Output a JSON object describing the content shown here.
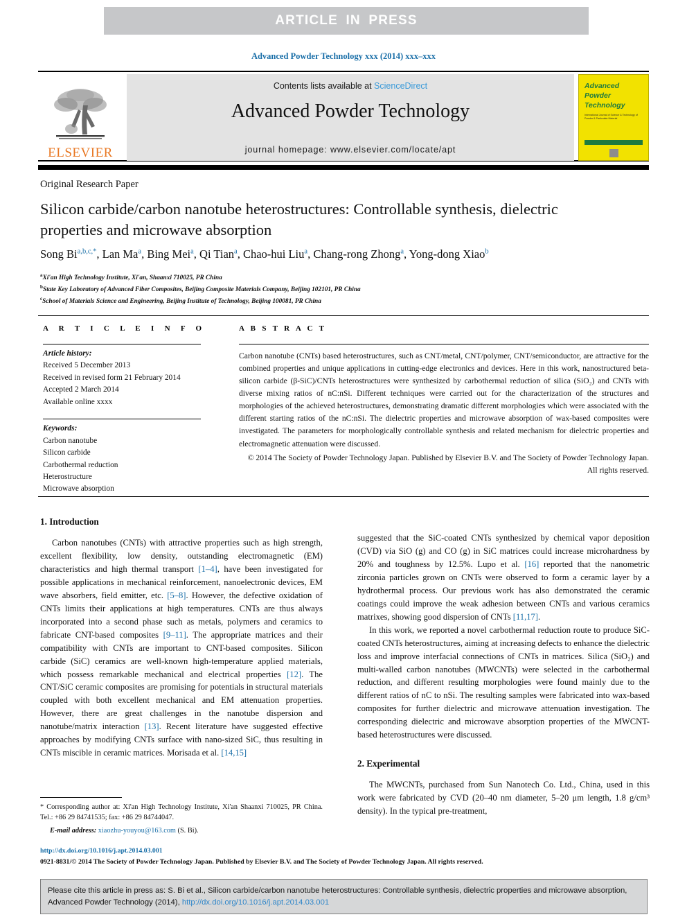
{
  "banner": {
    "label": "ARTICLE IN PRESS"
  },
  "running_head": "Advanced Powder Technology xxx (2014) xxx–xxx",
  "masthead": {
    "publisher_wordmark": "ELSEVIER",
    "contents_prefix": "Contents lists available at ",
    "contents_link": "ScienceDirect",
    "journal_title": "Advanced Powder Technology",
    "homepage": "journal homepage: www.elsevier.com/locate/apt",
    "cover": {
      "line1": "Advanced",
      "line2": "Powder",
      "line3": "Technology",
      "subtitle": "International Journal of Science & Technology of Powder & Particulate Material"
    }
  },
  "article": {
    "type": "Original Research Paper",
    "title": "Silicon carbide/carbon nanotube heterostructures: Controllable synthesis, dielectric properties and microwave absorption",
    "authors": [
      {
        "name": "Song Bi",
        "sup": "a,b,c,*"
      },
      {
        "name": "Lan Ma",
        "sup": "a"
      },
      {
        "name": "Bing Mei",
        "sup": "a"
      },
      {
        "name": "Qi Tian",
        "sup": "a"
      },
      {
        "name": "Chao-hui Liu",
        "sup": "a"
      },
      {
        "name": "Chang-rong Zhong",
        "sup": "a"
      },
      {
        "name": "Yong-dong Xiao",
        "sup": "b"
      }
    ],
    "affiliations": [
      {
        "marker": "a",
        "text": "Xi'an High Technology Institute, Xi'an, Shaanxi 710025, PR China"
      },
      {
        "marker": "b",
        "text": "State Key Laboratory of Advanced Fiber Composites, Beijing Composite Materials Company, Beijing 102101, PR China"
      },
      {
        "marker": "c",
        "text": "School of Materials Science and Engineering, Beijing Institute of Technology, Beijing 100081, PR China"
      }
    ]
  },
  "info_panel": {
    "heading_info": "A R T I C L E   I N F O",
    "heading_abstract": "A B S T R A C T",
    "history_label": "Article history:",
    "history": [
      "Received 5 December 2013",
      "Received in revised form 21 February 2014",
      "Accepted 2 March 2014",
      "Available online xxxx"
    ],
    "keywords_label": "Keywords:",
    "keywords": [
      "Carbon nanotube",
      "Silicon carbide",
      "Carbothermal reduction",
      "Heterostructure",
      "Microwave absorption"
    ]
  },
  "abstract": {
    "text": "Carbon nanotube (CNTs) based heterostructures, such as CNT/metal, CNT/polymer, CNT/semiconductor, are attractive for the combined properties and unique applications in cutting-edge electronics and devices. Here in this work, nanostructured beta-silicon carbide (β-SiC)/CNTs heterostructures were synthesized by carbothermal reduction of silica (SiO₂) and CNTs with diverse mixing ratios of nC:nSi. Different techniques were carried out for the characterization of the structures and morphologies of the achieved heterostructures, demonstrating dramatic different morphologies which were associated with the different starting ratios of the nC:nSi. The dielectric properties and microwave absorption of wax-based composites were investigated. The parameters for morphologically controllable synthesis and related mechanism for dielectric properties and electromagnetic attenuation were discussed.",
    "copyright": "© 2014 The Society of Powder Technology Japan. Published by Elsevier B.V. and The Society of Powder Technology Japan. All rights reserved."
  },
  "sections": {
    "introduction_heading": "1. Introduction",
    "experimental_heading": "2. Experimental",
    "intro_p1_a": "Carbon nanotubes (CNTs) with attractive properties such as high strength, excellent flexibility, low density, outstanding electromagnetic (EM) characteristics and high thermal transport ",
    "intro_ref_1_4": "[1–4]",
    "intro_p1_b": ", have been investigated for possible applications in mechanical reinforcement, nanoelectronic devices, EM wave absorbers, field emitter, etc. ",
    "intro_ref_5_8": "[5–8]",
    "intro_p1_c": ". However, the defective oxidation of CNTs limits their applications at high temperatures. CNTs are thus always incorporated into a second phase such as metals, polymers and ceramics to fabricate CNT-based composites ",
    "intro_ref_9_11": "[9–11]",
    "intro_p1_d": ". The appropriate matrices and their compatibility with CNTs are important to CNT-based composites. Silicon carbide (SiC) ceramics are well-known high-temperature applied materials, which possess remarkable mechanical and electrical properties ",
    "intro_ref_12": "[12]",
    "intro_p1_e": ". The CNT/SiC ceramic composites are promising for potentials in structural materials coupled with both excellent mechanical and EM attenuation properties. However, there are great challenges in the nanotube dispersion and nanotube/matrix interaction ",
    "intro_ref_13": "[13]",
    "intro_p1_f": ". Recent literature have suggested effective approaches by modifying CNTs surface with nano-sized SiC, thus resulting in CNTs miscible in ceramic matrices. Morisada et al. ",
    "intro_ref_14_15": "[14,15]",
    "intro_p1_g": " suggested that the SiC-coated CNTs synthesized by chemical vapor deposition (CVD) via SiO (g) and CO (g) in SiC matrices could increase microhardness by 20% and toughness by 12.5%. Lupo et al. ",
    "intro_ref_16": "[16]",
    "intro_p1_h": " reported that the nanometric zirconia particles grown on CNTs were observed to form a ceramic layer by a hydrothermal process. Our previous work has also demonstrated the ceramic coatings could improve the weak adhesion between CNTs and various ceramics matrixes, showing good dispersion of CNTs ",
    "intro_ref_11_17": "[11,17]",
    "intro_p1_i": ".",
    "intro_p2": "In this work, we reported a novel carbothermal reduction route to produce SiC-coated CNTs heterostructures, aiming at increasing defects to enhance the dielectric loss and improve interfacial connections of CNTs in matrices. Silica (SiO₂) and multi-walled carbon nanotubes (MWCNTs) were selected in the carbothermal reduction, and different resulting morphologies were found mainly due to the different ratios of nC to nSi. The resulting samples were fabricated into wax-based composites for further dielectric and microwave attenuation investigation. The corresponding dielectric and microwave absorption properties of the MWCNT-based heterostructures were discussed.",
    "experimental_p1": "The MWCNTs, purchased from Sun Nanotech Co. Ltd., China, used in this work were fabricated by CVD (20–40 nm diameter, 5–20 μm length, 1.8 g/cm³ density). In the typical pre-treatment,"
  },
  "footnote": {
    "corresponding": "* Corresponding author at: Xi'an High Technology Institute, Xi'an Shaanxi 710025, PR China. Tel.: +86 29 84741535; fax: +86 29 84744047.",
    "email_label": "E-mail address:",
    "email": "xiaozhu-youyou@163.com",
    "email_suffix": "(S. Bi)."
  },
  "footer": {
    "doi": "http://dx.doi.org/10.1016/j.apt.2014.03.001",
    "issn": "0921-8831/© 2014 The Society of Powder Technology Japan. Published by Elsevier B.V. and The Society of Powder Technology Japan. All rights reserved."
  },
  "citation_box": {
    "text_before": "Please cite this article in press as: S. Bi et al., Silicon carbide/carbon nanotube heterostructures: Controllable synthesis, dielectric properties and microwave absorption, Advanced Powder Technology (2014), ",
    "link": "http://dx.doi.org/10.1016/j.apt.2014.03.001"
  },
  "colors": {
    "banner_bg": "#c6c7c9",
    "link_blue": "#1a6fa8",
    "sciencedirect_blue": "#3a9ad9",
    "elsevier_orange": "#e87722",
    "cover_yellow": "#f2e200",
    "cover_green": "#1f7a3f",
    "cite_box_bg": "#d6d7d8"
  }
}
